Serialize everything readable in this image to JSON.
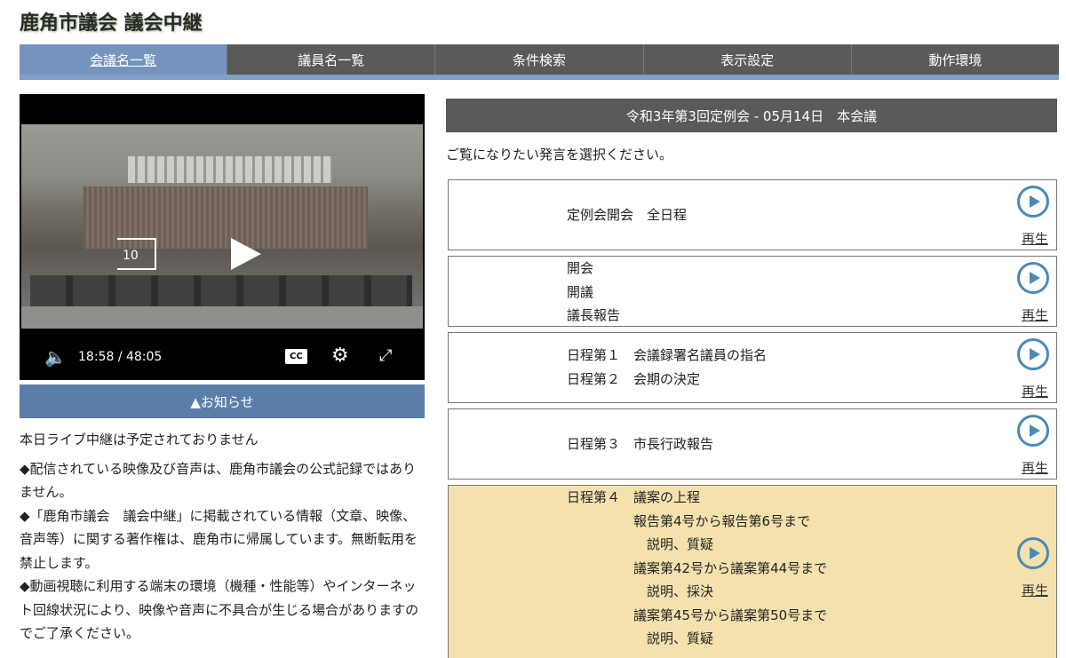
{
  "site": {
    "title": "鹿角市議会 議会中継"
  },
  "nav": [
    {
      "label": "会議名一覧"
    },
    {
      "label": "議員名一覧"
    },
    {
      "label": "条件検索"
    },
    {
      "label": "表示設定"
    },
    {
      "label": "動作環境"
    }
  ],
  "player": {
    "rewind_seconds": "10",
    "current_time": "18:58",
    "separator": "/",
    "duration": "48:05",
    "cc_label": "CC",
    "progress_fraction": 0.394
  },
  "notice": {
    "bar_label": "▲お知らせ",
    "lines": [
      "本日ライブ中継は予定されておりません",
      "◆配信されている映像及び音声は、鹿角市議会の公式記録ではありません。",
      "◆「鹿角市議会　議会中継」に掲載されている情報（文章、映像、音声等）に関する著作権は、鹿角市に帰属しています。無断転用を禁止します。",
      "◆動画視聴に利用する端末の環境（機種・性能等）やインターネット回線状況により、映像や音声に不具合が生じる場合がありますのでご了承ください。"
    ]
  },
  "meeting": {
    "title": "令和3年第3回定例会 - 05月14日　本会議",
    "instruction": "ご覧になりたい発言を選択ください。",
    "replay_label": "再生",
    "items": [
      {
        "text": "定例会開会　全日程"
      },
      {
        "text": "開会\n開議\n議長報告"
      },
      {
        "text": "日程第１　会議録署名議員の指名\n日程第２　会期の決定"
      },
      {
        "text": "日程第３　市長行政報告"
      },
      {
        "text": "日程第４　議案の上程\n　　　　　報告第4号から報告第6号まで\n　　　　　　説明、質疑\n　　　　　議案第42号から議案第44号まで\n　　　　　　説明、採決\n　　　　　議案第45号から議案第50号まで\n　　　　　　説明、質疑"
      }
    ]
  },
  "colors": {
    "nav_active": "#7494bd",
    "notice_bar": "#5b7ea8",
    "highlight": "#f5e1ad",
    "play_icon": "#4b8ab6"
  }
}
